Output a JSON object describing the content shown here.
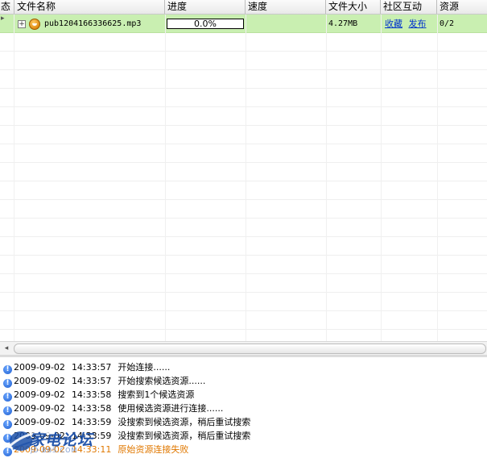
{
  "columns": [
    "态",
    "文件名称",
    "进度",
    "速度",
    "文件大小",
    "社区互动",
    "资源"
  ],
  "tasks": [
    {
      "name": "pub1204166336625.mp3",
      "progress_text": "0.0%",
      "progress_fraction": 0.0,
      "speed": "",
      "size": "4.27MB",
      "link_collect": "收藏",
      "link_publish": "发布",
      "sources": "0/2"
    }
  ],
  "log": [
    {
      "date": "2009-09-02",
      "time": "14:33:57",
      "msg": "开始连接......"
    },
    {
      "date": "2009-09-02",
      "time": "14:33:57",
      "msg": "开始搜索候选资源......"
    },
    {
      "date": "2009-09-02",
      "time": "14:33:58",
      "msg": "搜索到1个候选资源"
    },
    {
      "date": "2009-09-02",
      "time": "14:33:58",
      "msg": "使用候选资源进行连接......"
    },
    {
      "date": "2009-09-02",
      "time": "14:33:59",
      "msg": "没搜索到候选资源，稍后重试搜索"
    },
    {
      "date": "2009-09-02",
      "time": "14:33:59",
      "msg": "没搜索到候选资源，稍后重试搜索"
    },
    {
      "date": "2009-09-02",
      "time": "14:33:11",
      "msg": "原始资源连接失败"
    }
  ],
  "watermark": {
    "title": "家电论坛",
    "subtitle": "JD-BBS.COM"
  },
  "colors": {
    "selected_row": "#c9efb1",
    "link": "#0033cc",
    "error_text": "#e07800",
    "watermark": "#1a4fa8"
  }
}
